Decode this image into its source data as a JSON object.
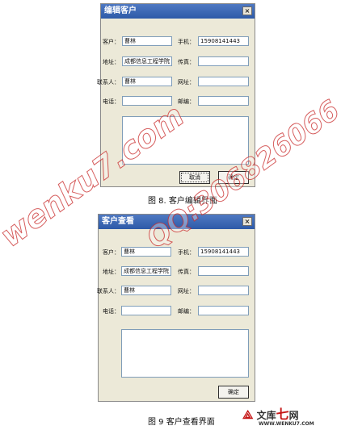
{
  "edit_window": {
    "title": "编辑客户",
    "close_glyph": "×",
    "fields": {
      "customer": {
        "label": "客户：",
        "value": "曹林"
      },
      "phone": {
        "label": "手机：",
        "value": "15908141443"
      },
      "address": {
        "label": "地址：",
        "value": "成都信息工程学院"
      },
      "fax": {
        "label": "传真：",
        "value": ""
      },
      "contact": {
        "label": "联系人：",
        "value": "曹林"
      },
      "website": {
        "label": "网址：",
        "value": ""
      },
      "telephone": {
        "label": "电话：",
        "value": ""
      },
      "email": {
        "label": "邮编：",
        "value": ""
      }
    },
    "buttons": {
      "cancel": "取消",
      "ok": "确定"
    }
  },
  "caption1": "图 8. 客户编辑界面",
  "view_window": {
    "title": "客户查看",
    "close_glyph": "×",
    "fields": {
      "customer": {
        "label": "客户：",
        "value": "曹林"
      },
      "phone": {
        "label": "手机：",
        "value": "15908141443"
      },
      "address": {
        "label": "地址：",
        "value": "成都信息工程学院"
      },
      "fax": {
        "label": "传真：",
        "value": ""
      },
      "contact": {
        "label": "联系人：",
        "value": "曹林"
      },
      "website": {
        "label": "网址：",
        "value": ""
      },
      "telephone": {
        "label": "电话：",
        "value": ""
      },
      "email": {
        "label": "邮编：",
        "value": ""
      }
    },
    "buttons": {
      "ok": "确定"
    }
  },
  "caption2": "图 9  客户查看界面",
  "watermark": {
    "text1": "wenku7.com",
    "text2": "QQ:306826066"
  },
  "logo": {
    "text": "文库",
    "seven": "七",
    "net": "网",
    "url": "WWW.WENKU7.COM"
  }
}
